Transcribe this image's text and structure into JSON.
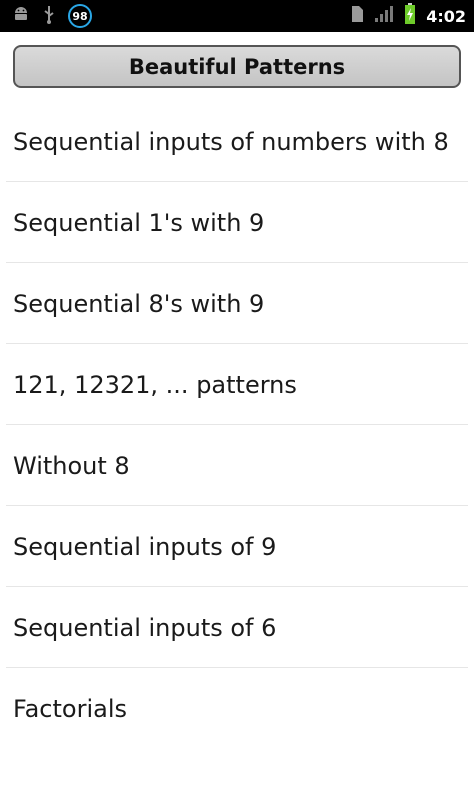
{
  "status_bar": {
    "notification_count": "98",
    "time": "4:02",
    "icons": [
      "android-icon",
      "usb-icon",
      "sd-card-icon",
      "signal-icon",
      "battery-icon"
    ],
    "badge_color": "#2aa7e6",
    "battery_color": "#6ecb2a"
  },
  "header": {
    "title": "Beautiful Patterns"
  },
  "list": {
    "items": [
      {
        "label": "Sequential inputs of numbers with 8"
      },
      {
        "label": "Sequential 1's with 9"
      },
      {
        "label": "Sequential 8's with 9"
      },
      {
        "label": "121, 12321, ... patterns"
      },
      {
        "label": "Without 8"
      },
      {
        "label": "Sequential inputs of 9"
      },
      {
        "label": "Sequential inputs of 6"
      },
      {
        "label": "Factorials"
      }
    ]
  }
}
